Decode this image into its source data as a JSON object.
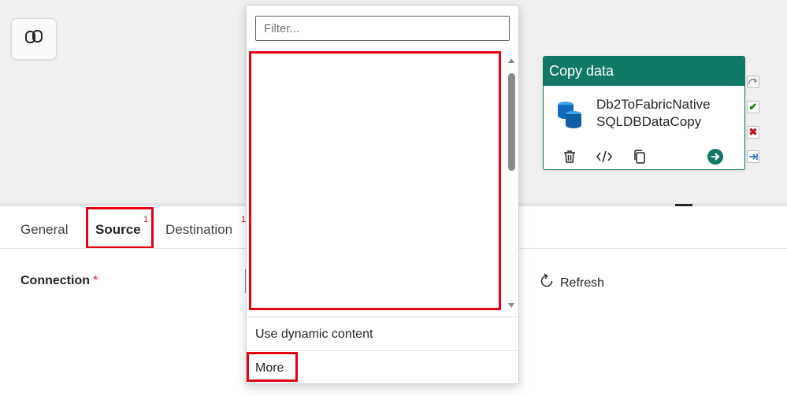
{
  "canvas": {
    "copilot_icon": "copilot-icon",
    "activity": {
      "type_label": "Copy data",
      "name_line1": "Db2ToFabricNative",
      "name_line2": "SQLDBDataCopy",
      "icon": "database-icon",
      "actions": [
        "delete-icon",
        "code-icon",
        "copy-icon",
        "arrow-right-circle-icon"
      ],
      "side_status": [
        "skip-icon",
        "success-icon",
        "fail-icon",
        "completion-icon"
      ],
      "accent_color": "#117865"
    }
  },
  "tabs": [
    {
      "label": "General",
      "badge": ""
    },
    {
      "label": "Source",
      "badge": "1"
    },
    {
      "label": "Destination",
      "badge": "1"
    }
  ],
  "connection": {
    "label": "Connection",
    "required_mark": "*",
    "refresh_label": "Refresh"
  },
  "dropdown": {
    "filter_placeholder": "Filter...",
    "dynamic_content_label": "Use dynamic content",
    "more_label": "More"
  },
  "highlight_color": "#e3000f"
}
